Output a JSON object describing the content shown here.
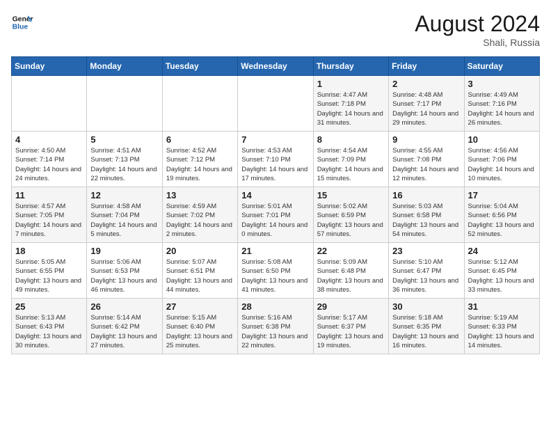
{
  "header": {
    "logo_line1": "General",
    "logo_line2": "Blue",
    "month_year": "August 2024",
    "location": "Shali, Russia"
  },
  "weekdays": [
    "Sunday",
    "Monday",
    "Tuesday",
    "Wednesday",
    "Thursday",
    "Friday",
    "Saturday"
  ],
  "weeks": [
    [
      {
        "day": "",
        "sunrise": "",
        "sunset": "",
        "daylight": ""
      },
      {
        "day": "",
        "sunrise": "",
        "sunset": "",
        "daylight": ""
      },
      {
        "day": "",
        "sunrise": "",
        "sunset": "",
        "daylight": ""
      },
      {
        "day": "",
        "sunrise": "",
        "sunset": "",
        "daylight": ""
      },
      {
        "day": "1",
        "sunrise": "Sunrise: 4:47 AM",
        "sunset": "Sunset: 7:18 PM",
        "daylight": "Daylight: 14 hours and 31 minutes."
      },
      {
        "day": "2",
        "sunrise": "Sunrise: 4:48 AM",
        "sunset": "Sunset: 7:17 PM",
        "daylight": "Daylight: 14 hours and 29 minutes."
      },
      {
        "day": "3",
        "sunrise": "Sunrise: 4:49 AM",
        "sunset": "Sunset: 7:16 PM",
        "daylight": "Daylight: 14 hours and 26 minutes."
      }
    ],
    [
      {
        "day": "4",
        "sunrise": "Sunrise: 4:50 AM",
        "sunset": "Sunset: 7:14 PM",
        "daylight": "Daylight: 14 hours and 24 minutes."
      },
      {
        "day": "5",
        "sunrise": "Sunrise: 4:51 AM",
        "sunset": "Sunset: 7:13 PM",
        "daylight": "Daylight: 14 hours and 22 minutes."
      },
      {
        "day": "6",
        "sunrise": "Sunrise: 4:52 AM",
        "sunset": "Sunset: 7:12 PM",
        "daylight": "Daylight: 14 hours and 19 minutes."
      },
      {
        "day": "7",
        "sunrise": "Sunrise: 4:53 AM",
        "sunset": "Sunset: 7:10 PM",
        "daylight": "Daylight: 14 hours and 17 minutes."
      },
      {
        "day": "8",
        "sunrise": "Sunrise: 4:54 AM",
        "sunset": "Sunset: 7:09 PM",
        "daylight": "Daylight: 14 hours and 15 minutes."
      },
      {
        "day": "9",
        "sunrise": "Sunrise: 4:55 AM",
        "sunset": "Sunset: 7:08 PM",
        "daylight": "Daylight: 14 hours and 12 minutes."
      },
      {
        "day": "10",
        "sunrise": "Sunrise: 4:56 AM",
        "sunset": "Sunset: 7:06 PM",
        "daylight": "Daylight: 14 hours and 10 minutes."
      }
    ],
    [
      {
        "day": "11",
        "sunrise": "Sunrise: 4:57 AM",
        "sunset": "Sunset: 7:05 PM",
        "daylight": "Daylight: 14 hours and 7 minutes."
      },
      {
        "day": "12",
        "sunrise": "Sunrise: 4:58 AM",
        "sunset": "Sunset: 7:04 PM",
        "daylight": "Daylight: 14 hours and 5 minutes."
      },
      {
        "day": "13",
        "sunrise": "Sunrise: 4:59 AM",
        "sunset": "Sunset: 7:02 PM",
        "daylight": "Daylight: 14 hours and 2 minutes."
      },
      {
        "day": "14",
        "sunrise": "Sunrise: 5:01 AM",
        "sunset": "Sunset: 7:01 PM",
        "daylight": "Daylight: 14 hours and 0 minutes."
      },
      {
        "day": "15",
        "sunrise": "Sunrise: 5:02 AM",
        "sunset": "Sunset: 6:59 PM",
        "daylight": "Daylight: 13 hours and 57 minutes."
      },
      {
        "day": "16",
        "sunrise": "Sunrise: 5:03 AM",
        "sunset": "Sunset: 6:58 PM",
        "daylight": "Daylight: 13 hours and 54 minutes."
      },
      {
        "day": "17",
        "sunrise": "Sunrise: 5:04 AM",
        "sunset": "Sunset: 6:56 PM",
        "daylight": "Daylight: 13 hours and 52 minutes."
      }
    ],
    [
      {
        "day": "18",
        "sunrise": "Sunrise: 5:05 AM",
        "sunset": "Sunset: 6:55 PM",
        "daylight": "Daylight: 13 hours and 49 minutes."
      },
      {
        "day": "19",
        "sunrise": "Sunrise: 5:06 AM",
        "sunset": "Sunset: 6:53 PM",
        "daylight": "Daylight: 13 hours and 46 minutes."
      },
      {
        "day": "20",
        "sunrise": "Sunrise: 5:07 AM",
        "sunset": "Sunset: 6:51 PM",
        "daylight": "Daylight: 13 hours and 44 minutes."
      },
      {
        "day": "21",
        "sunrise": "Sunrise: 5:08 AM",
        "sunset": "Sunset: 6:50 PM",
        "daylight": "Daylight: 13 hours and 41 minutes."
      },
      {
        "day": "22",
        "sunrise": "Sunrise: 5:09 AM",
        "sunset": "Sunset: 6:48 PM",
        "daylight": "Daylight: 13 hours and 38 minutes."
      },
      {
        "day": "23",
        "sunrise": "Sunrise: 5:10 AM",
        "sunset": "Sunset: 6:47 PM",
        "daylight": "Daylight: 13 hours and 36 minutes."
      },
      {
        "day": "24",
        "sunrise": "Sunrise: 5:12 AM",
        "sunset": "Sunset: 6:45 PM",
        "daylight": "Daylight: 13 hours and 33 minutes."
      }
    ],
    [
      {
        "day": "25",
        "sunrise": "Sunrise: 5:13 AM",
        "sunset": "Sunset: 6:43 PM",
        "daylight": "Daylight: 13 hours and 30 minutes."
      },
      {
        "day": "26",
        "sunrise": "Sunrise: 5:14 AM",
        "sunset": "Sunset: 6:42 PM",
        "daylight": "Daylight: 13 hours and 27 minutes."
      },
      {
        "day": "27",
        "sunrise": "Sunrise: 5:15 AM",
        "sunset": "Sunset: 6:40 PM",
        "daylight": "Daylight: 13 hours and 25 minutes."
      },
      {
        "day": "28",
        "sunrise": "Sunrise: 5:16 AM",
        "sunset": "Sunset: 6:38 PM",
        "daylight": "Daylight: 13 hours and 22 minutes."
      },
      {
        "day": "29",
        "sunrise": "Sunrise: 5:17 AM",
        "sunset": "Sunset: 6:37 PM",
        "daylight": "Daylight: 13 hours and 19 minutes."
      },
      {
        "day": "30",
        "sunrise": "Sunrise: 5:18 AM",
        "sunset": "Sunset: 6:35 PM",
        "daylight": "Daylight: 13 hours and 16 minutes."
      },
      {
        "day": "31",
        "sunrise": "Sunrise: 5:19 AM",
        "sunset": "Sunset: 6:33 PM",
        "daylight": "Daylight: 13 hours and 14 minutes."
      }
    ]
  ]
}
